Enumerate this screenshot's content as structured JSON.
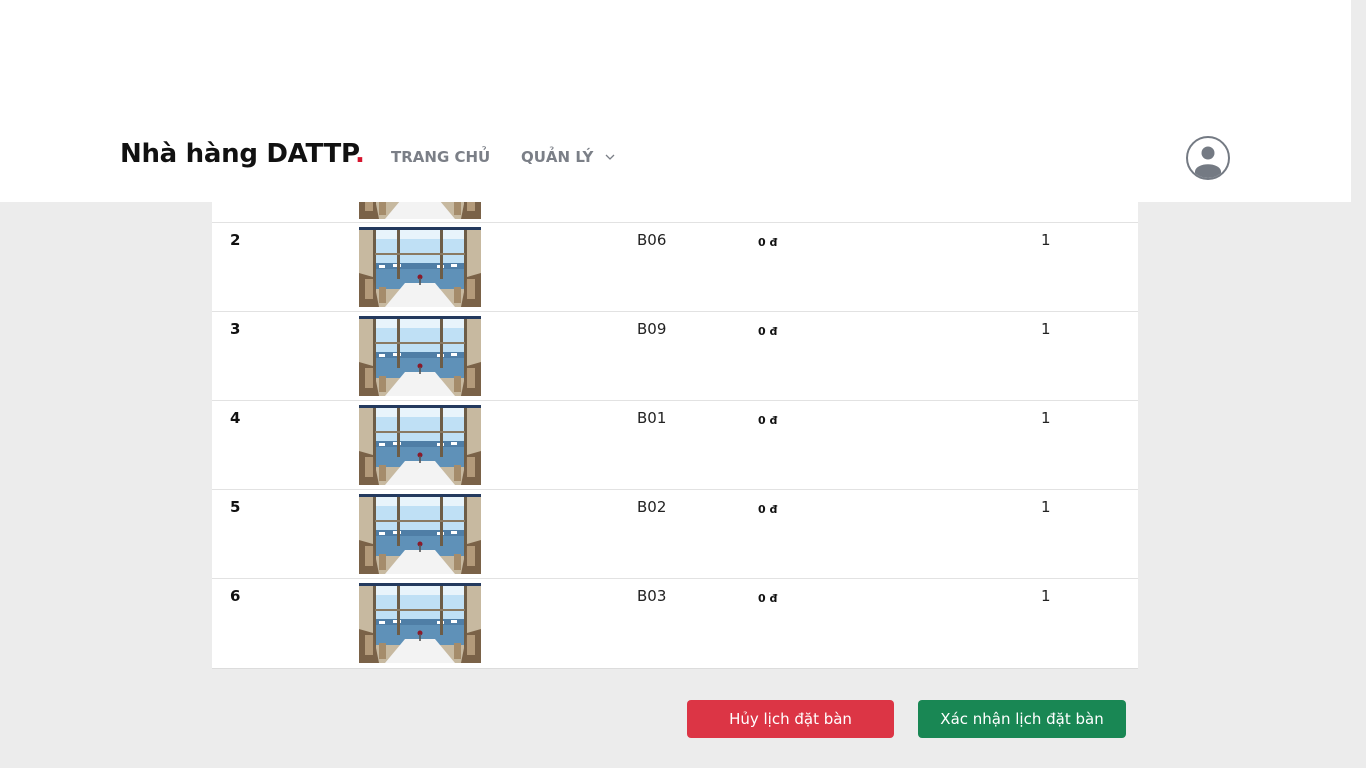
{
  "brand": {
    "name": "Nhà hàng DATTP",
    "dot": "."
  },
  "nav": {
    "home": "TRANG CHỦ",
    "manage": "QUẢN LÝ"
  },
  "table": {
    "rows": [
      {
        "index": "",
        "code": "",
        "price": "",
        "qty": ""
      },
      {
        "index": "2",
        "code": "B06",
        "price": "0 đ",
        "qty": "1"
      },
      {
        "index": "3",
        "code": "B09",
        "price": "0 đ",
        "qty": "1"
      },
      {
        "index": "4",
        "code": "B01",
        "price": "0 đ",
        "qty": "1"
      },
      {
        "index": "5",
        "code": "B02",
        "price": "0 đ",
        "qty": "1"
      },
      {
        "index": "6",
        "code": "B03",
        "price": "0 đ",
        "qty": "1"
      }
    ]
  },
  "actions": {
    "cancel_label": "Hủy lịch đặt bàn",
    "confirm_label": "Xác nhận lịch đặt bàn"
  },
  "icons": {
    "user": "user-avatar-icon",
    "chevron": "chevron-down-icon",
    "table_photo": "dining-table-photo"
  },
  "colors": {
    "brand_dot": "#d6152e",
    "cancel": "#dc3545",
    "confirm": "#198754",
    "nav_text": "#7b7f87"
  }
}
